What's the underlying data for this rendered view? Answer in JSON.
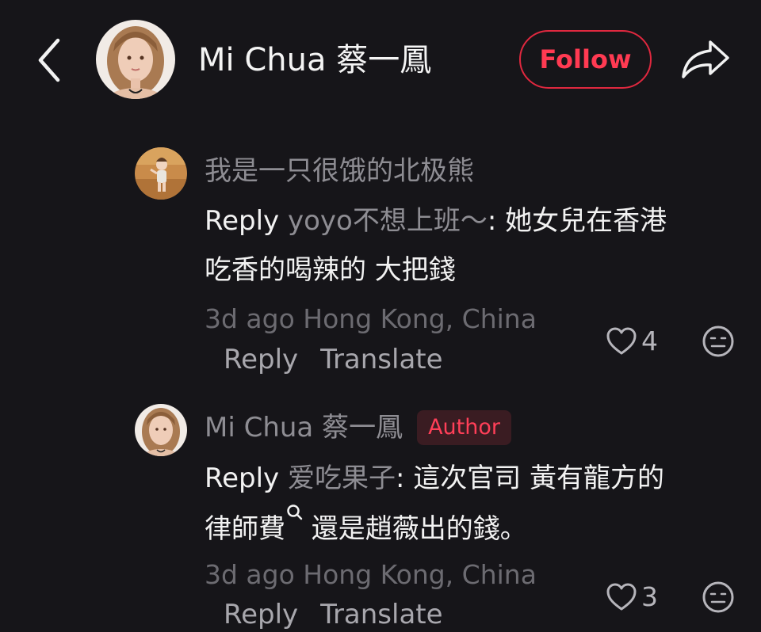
{
  "header": {
    "user_name": "Mi Chua 蔡一鳳",
    "follow_label": "Follow",
    "back_icon": "chevron-left-icon",
    "share_icon": "share-arrow-icon",
    "accent_color": "#e0283f"
  },
  "comments": [
    {
      "username": "我是一只很饿的北极熊",
      "text_prefix": "Reply",
      "reply_to": "yoyo不想上班～",
      "text_line1": ": 她女兒在香港",
      "text_line2": "吃香的喝辣的 大把錢",
      "meta": "3d ago Hong Kong, China",
      "reply_label": "Reply",
      "translate_label": "Translate",
      "like_count": "4",
      "is_author": false
    },
    {
      "username": "Mi Chua 蔡一鳳",
      "author_badge": "Author",
      "text_prefix": "Reply",
      "reply_to": "爱吃果子",
      "text_line1": ": 這次官司 黃有龍方的",
      "text_line2_a": "律師費",
      "text_line2_b": " 還是趙薇出的錢。",
      "meta": "3d ago Hong Kong, China",
      "reply_label": "Reply",
      "translate_label": "Translate",
      "like_count": "3",
      "is_author": true
    }
  ]
}
